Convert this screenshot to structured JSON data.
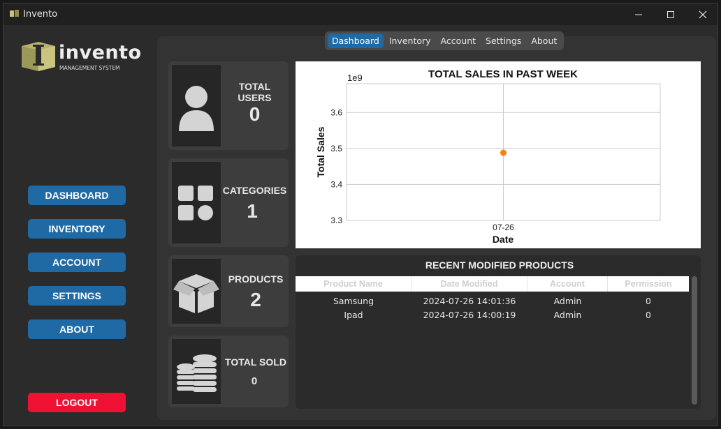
{
  "window": {
    "title": "Invento"
  },
  "logo": {
    "word": "invento",
    "subtitle": "MANAGEMENT SYSTEM"
  },
  "sidebar": {
    "buttons": [
      "DASHBOARD",
      "INVENTORY",
      "ACCOUNT",
      "SETTINGS",
      "ABOUT"
    ],
    "logout": "LOGOUT"
  },
  "tabs": [
    "Dashboard",
    "Inventory",
    "Account",
    "Settings",
    "About"
  ],
  "active_tab": "Dashboard",
  "cards": [
    {
      "label": "TOTAL USERS",
      "value": "0",
      "icon": "user-icon"
    },
    {
      "label": "CATEGORIES",
      "value": "1",
      "icon": "categories-icon"
    },
    {
      "label": "PRODUCTS",
      "value": "2",
      "icon": "box-icon"
    },
    {
      "label": "TOTAL SOLD",
      "value": "0",
      "icon": "coins-icon"
    }
  ],
  "chart_data": {
    "type": "scatter",
    "title": "TOTAL SALES IN PAST WEEK",
    "xlabel": "Date",
    "ylabel": "Total Sales",
    "offset_label": "1e9",
    "x": [
      "07-26"
    ],
    "y": [
      3.488
    ],
    "ylim": [
      3.3,
      3.68
    ],
    "yticks": [
      "3.3",
      "3.4",
      "3.5",
      "3.6"
    ],
    "grid": true,
    "point_color": "#ff7f0e"
  },
  "recent": {
    "title": "RECENT MODIFIED PRODUCTS",
    "columns": [
      "Product Name",
      "Date Modified",
      "Account",
      "Permission"
    ],
    "rows": [
      [
        "Samsung",
        "2024-07-26 14:01:36",
        "Admin",
        "0"
      ],
      [
        "Ipad",
        "2024-07-26 14:00:19",
        "Admin",
        "0"
      ]
    ]
  },
  "colors": {
    "accent": "#1f6aa5",
    "logout": "#ee1133",
    "background": "#2b2b2b"
  }
}
